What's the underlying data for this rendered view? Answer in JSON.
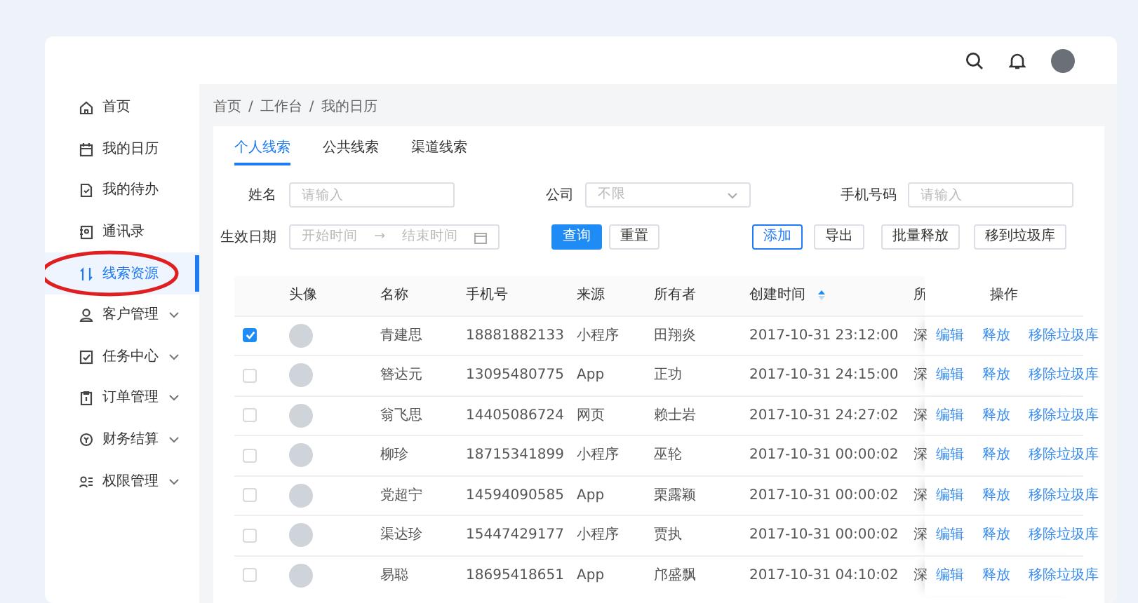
{
  "sidebar": {
    "items": [
      {
        "label": "首页",
        "expandable": false,
        "selected": false,
        "circled": false
      },
      {
        "label": "我的日历",
        "expandable": false,
        "selected": false,
        "circled": false
      },
      {
        "label": "我的待办",
        "expandable": false,
        "selected": false,
        "circled": false
      },
      {
        "label": "通讯录",
        "expandable": false,
        "selected": false,
        "circled": false
      },
      {
        "label": "线索资源",
        "expandable": false,
        "selected": true,
        "circled": true
      },
      {
        "label": "客户管理",
        "expandable": true,
        "selected": false,
        "circled": false
      },
      {
        "label": "任务中心",
        "expandable": true,
        "selected": false,
        "circled": false
      },
      {
        "label": "订单管理",
        "expandable": true,
        "selected": false,
        "circled": false
      },
      {
        "label": "财务结算",
        "expandable": true,
        "selected": false,
        "circled": false
      },
      {
        "label": "权限管理",
        "expandable": true,
        "selected": false,
        "circled": false
      }
    ]
  },
  "breadcrumb": {
    "items": [
      "首页",
      "工作台",
      "我的日历"
    ],
    "separator": "/"
  },
  "tabs": [
    {
      "label": "个人线索",
      "selected": true
    },
    {
      "label": "公共线索",
      "selected": false
    },
    {
      "label": "渠道线索",
      "selected": false
    }
  ],
  "filters": {
    "name": {
      "label": "姓名",
      "placeholder": "请输入"
    },
    "company": {
      "label": "公司",
      "placeholder": "不限"
    },
    "phone": {
      "label": "手机号码",
      "placeholder": "请输入"
    },
    "date": {
      "label": "生效日期",
      "start_placeholder": "开始时间",
      "arrow": "→",
      "end_placeholder": "结束时间"
    }
  },
  "search_buttons": [
    {
      "label": "查询",
      "kind": "primary"
    },
    {
      "label": "重置",
      "kind": "default"
    }
  ],
  "action_buttons": [
    {
      "label": "添加",
      "kind": "outline"
    },
    {
      "label": "导出",
      "kind": "default"
    },
    {
      "label": "批量释放",
      "kind": "default"
    },
    {
      "label": "移到垃圾库",
      "kind": "default"
    }
  ],
  "table": {
    "columns": [
      {
        "label": "头像",
        "sorted": false
      },
      {
        "label": "名称",
        "sorted": false
      },
      {
        "label": "手机号",
        "sorted": false
      },
      {
        "label": "来源",
        "sorted": false
      },
      {
        "label": "所有者",
        "sorted": false
      },
      {
        "label": "创建时间",
        "sorted": true
      },
      {
        "label": "所",
        "sorted": false
      },
      {
        "label": "操作",
        "sorted": false
      }
    ],
    "rows": [
      {
        "selected": true,
        "name": "青建思",
        "phone": "18881882133",
        "source": "小程序",
        "owner": "田翔炎",
        "created": "2017-10-31  23:12:00",
        "column_7": "深",
        "actions": [
          "编辑",
          "释放",
          "移除垃圾库"
        ]
      },
      {
        "selected": false,
        "name": "簪达元",
        "phone": "13095480775",
        "source": "App",
        "owner": "正功",
        "created": "2017-10-31  24:15:00",
        "column_7": "深",
        "actions": [
          "编辑",
          "释放",
          "移除垃圾库"
        ]
      },
      {
        "selected": false,
        "name": "翁飞思",
        "phone": "14405086724",
        "source": "网页",
        "owner": "赖士岩",
        "created": "2017-10-31  24:27:02",
        "column_7": "深",
        "actions": [
          "编辑",
          "释放",
          "移除垃圾库"
        ]
      },
      {
        "selected": false,
        "name": "柳珍",
        "phone": "18715341899",
        "source": "小程序",
        "owner": "巫轮",
        "created": "2017-10-31  00:00:02",
        "column_7": "深",
        "actions": [
          "编辑",
          "释放",
          "移除垃圾库"
        ]
      },
      {
        "selected": false,
        "name": "党超宁",
        "phone": "14594090585",
        "source": "App",
        "owner": "栗露颖",
        "created": "2017-10-31  00:00:02",
        "column_7": "深",
        "actions": [
          "编辑",
          "释放",
          "移除垃圾库"
        ]
      },
      {
        "selected": false,
        "name": "渠达珍",
        "phone": "15447429177",
        "source": "小程序",
        "owner": "贾执",
        "created": "2017-10-31  00:00:02",
        "column_7": "深",
        "actions": [
          "编辑",
          "释放",
          "移除垃圾库"
        ]
      },
      {
        "selected": false,
        "name": "易聪",
        "phone": "18695418651",
        "source": "App",
        "owner": "邝盛飘",
        "created": "2017-10-31  04:10:02",
        "column_7": "深",
        "actions": [
          "编辑",
          "释放",
          "移除垃圾库"
        ]
      }
    ]
  }
}
